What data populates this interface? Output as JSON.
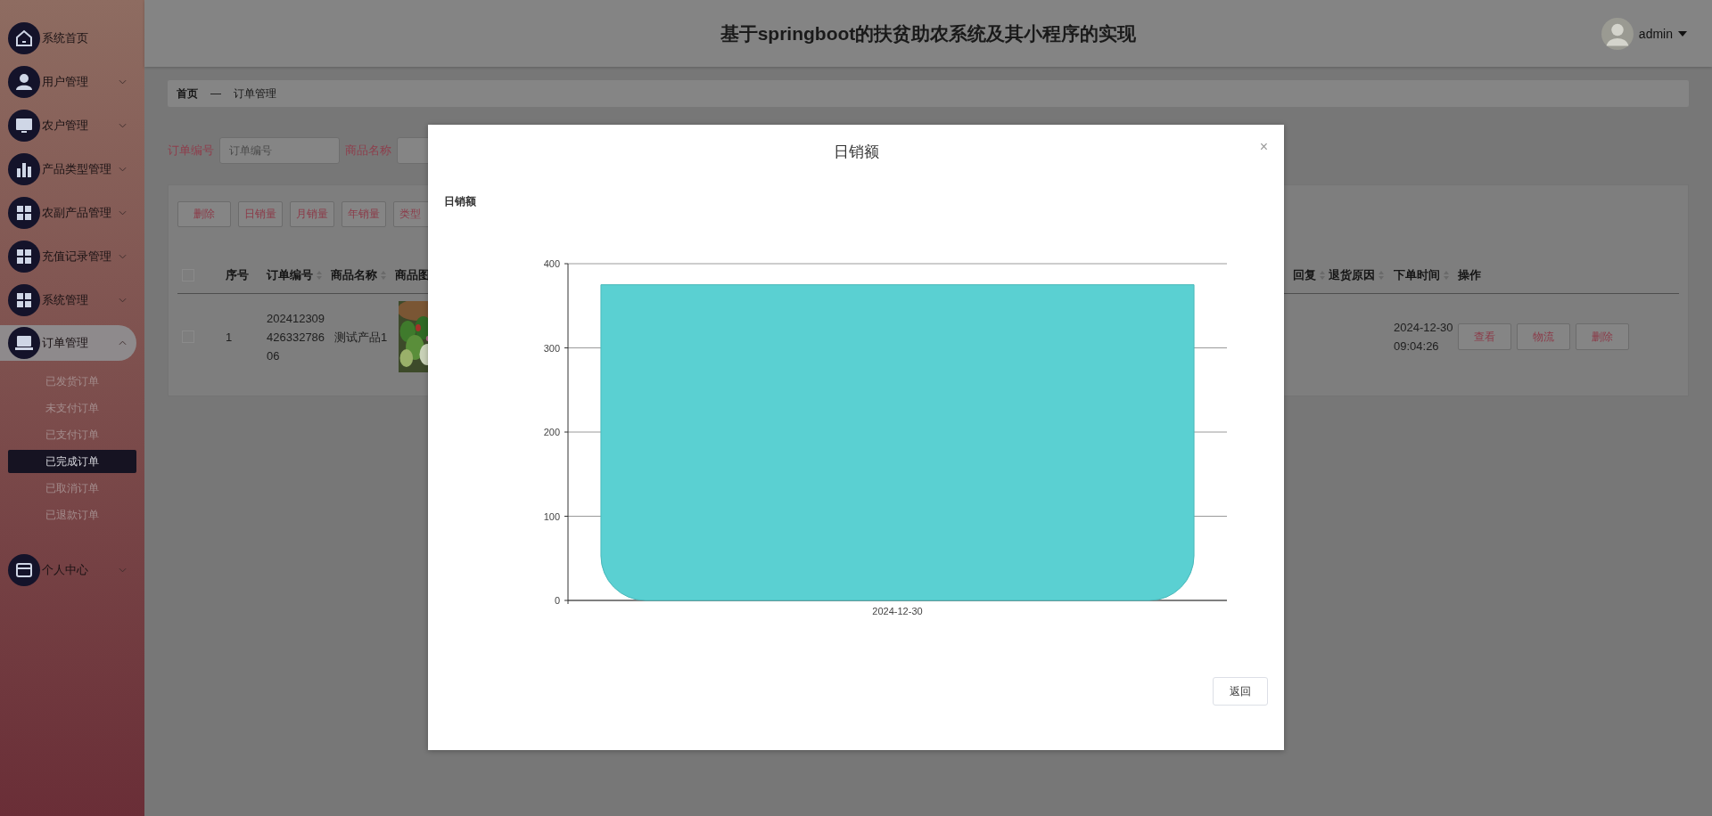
{
  "sidebar": {
    "items": [
      {
        "label": "系统首页"
      },
      {
        "label": "用户管理",
        "expanded": false
      },
      {
        "label": "农户管理",
        "expanded": false
      },
      {
        "label": "产品类型管理",
        "expanded": false
      },
      {
        "label": "农副产品管理",
        "expanded": false
      },
      {
        "label": "充值记录管理",
        "expanded": false
      },
      {
        "label": "系统管理",
        "expanded": false
      },
      {
        "label": "订单管理",
        "expanded": true,
        "children": [
          {
            "label": "已发货订单",
            "selected": false
          },
          {
            "label": "未支付订单",
            "selected": false
          },
          {
            "label": "已支付订单",
            "selected": false
          },
          {
            "label": "已完成订单",
            "selected": true
          },
          {
            "label": "已取消订单",
            "selected": false
          },
          {
            "label": "已退款订单",
            "selected": false
          }
        ]
      },
      {
        "label": "个人中心",
        "expanded": false
      }
    ]
  },
  "header": {
    "title": "基于springboot的扶贫助农系统及其小程序的实现",
    "user": "admin"
  },
  "breadcrumb": {
    "items": [
      "首页",
      "订单管理"
    ],
    "separator": "—"
  },
  "search": {
    "fields": [
      {
        "label": "订单编号",
        "placeholder": "订单编号"
      },
      {
        "label": "商品名称"
      }
    ]
  },
  "toolbar": {
    "buttons": [
      "删除",
      "日销量",
      "月销量",
      "年销量",
      "类型"
    ]
  },
  "table": {
    "select_all": {
      "checked": false
    },
    "columns_left": [
      {
        "label": "序号",
        "sortable": false
      },
      {
        "label": "订单编号",
        "sortable": true
      },
      {
        "label": "商品名称",
        "sortable": true
      },
      {
        "label": "商品图",
        "sortable": false
      }
    ],
    "columns_right": [
      {
        "label": "回复",
        "sortable": true
      },
      {
        "label": "退货原因",
        "sortable": true
      },
      {
        "label": "下单时间",
        "sortable": true
      },
      {
        "label": "操作",
        "sortable": false
      }
    ],
    "rows": [
      {
        "checked": false,
        "index": "1",
        "order_no": "20241230942633278606",
        "product": "测试产品1",
        "picture": {
          "kind": "picture"
        },
        "time": "2024-12-30 09:04:26",
        "actions": [
          "查看",
          "物流",
          "删除"
        ]
      }
    ]
  },
  "dialog": {
    "title": "日销额",
    "close": "×",
    "chart_data": {
      "type": "bar",
      "title": "日销额",
      "categories": [
        "2024-12-30"
      ],
      "values": [
        375
      ],
      "ylim": [
        0,
        400
      ],
      "grid": true,
      "yticks": [
        0,
        100,
        200,
        300,
        400
      ]
    },
    "buttons": [
      "返回"
    ]
  }
}
